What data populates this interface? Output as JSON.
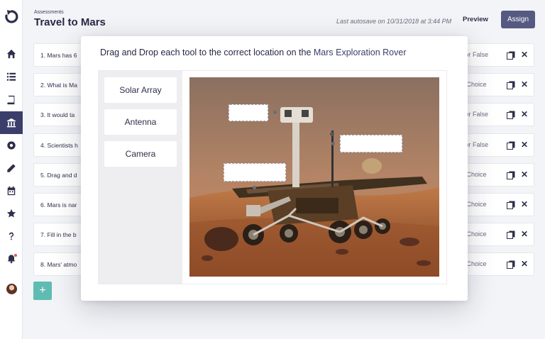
{
  "header": {
    "breadcrumb": "Assessments",
    "title": "Travel to Mars",
    "autosave": "Last autosave on 10/31/2018 at 3:44 PM",
    "preview_label": "Preview",
    "assign_label": "Assign"
  },
  "sidebar": {
    "icons": [
      "home-icon",
      "list-icon",
      "book-icon",
      "bank-icon",
      "record-icon",
      "pencil-icon",
      "calendar-icon",
      "star-icon",
      "help-icon",
      "bell-icon"
    ]
  },
  "questions": [
    {
      "text": "1. Mars has 6",
      "type": "e or False"
    },
    {
      "text": "2. What is Ma",
      "type": "le Choice"
    },
    {
      "text": "3. It would ta",
      "type": "e or False"
    },
    {
      "text": "4. Scientists h",
      "type": "e or False"
    },
    {
      "text": "5. Drag and d",
      "type": "le Choice"
    },
    {
      "text": "6. Mars is nar",
      "type": "le Choice"
    },
    {
      "text": "7. Fill in the b",
      "type": "le Choice"
    },
    {
      "text": "8. Mars' atmo",
      "type": "le Choice"
    }
  ],
  "add_label": "+",
  "modal": {
    "title_main": "Drag and Drop each tool to the correct location on the ",
    "title_accent": "Mars Exploration Rover",
    "tools": [
      "Solar Array",
      "Antenna",
      "Camera"
    ]
  },
  "colors": {
    "nav_active": "#3b3d6b",
    "assign_button": "#565a82",
    "add_button": "#5fbcb3"
  }
}
